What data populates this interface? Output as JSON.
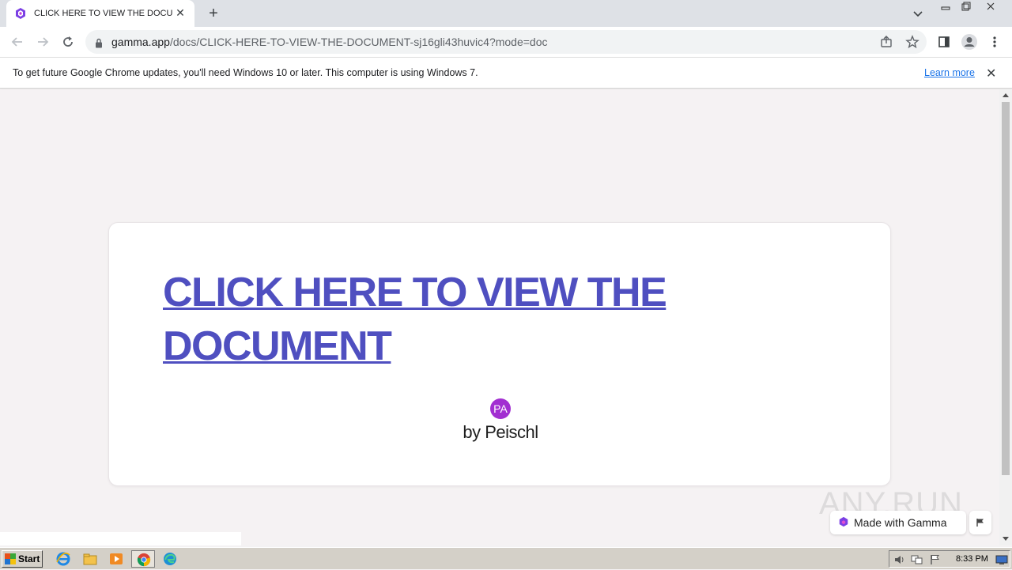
{
  "browser": {
    "tab_title": "CLICK HERE TO VIEW THE DOCUMENT",
    "tab_close": "✕",
    "new_tab": "+",
    "url_host": "gamma.app",
    "url_path": "/docs/CLICK-HERE-TO-VIEW-THE-DOCUMENT-sj16gli43huvic4?mode=doc"
  },
  "infobar": {
    "message": "To get future Google Chrome updates, you'll need Windows 10 or later. This computer is using Windows 7.",
    "link": "Learn more",
    "close": "✕"
  },
  "document": {
    "heading": "CLICK HERE TO VIEW THE DOCUMENT",
    "avatar_initials": "PA",
    "byline": "by Peischl"
  },
  "overlay": {
    "watermark": "ANY.RUN",
    "badge_label": "Made with Gamma"
  },
  "taskbar": {
    "start_label": "Start",
    "clock": "8:33 PM"
  },
  "colors": {
    "heading_link": "#4f4fc0",
    "avatar": "#a22fd1",
    "gamma_brand": "#7b3fe4"
  }
}
